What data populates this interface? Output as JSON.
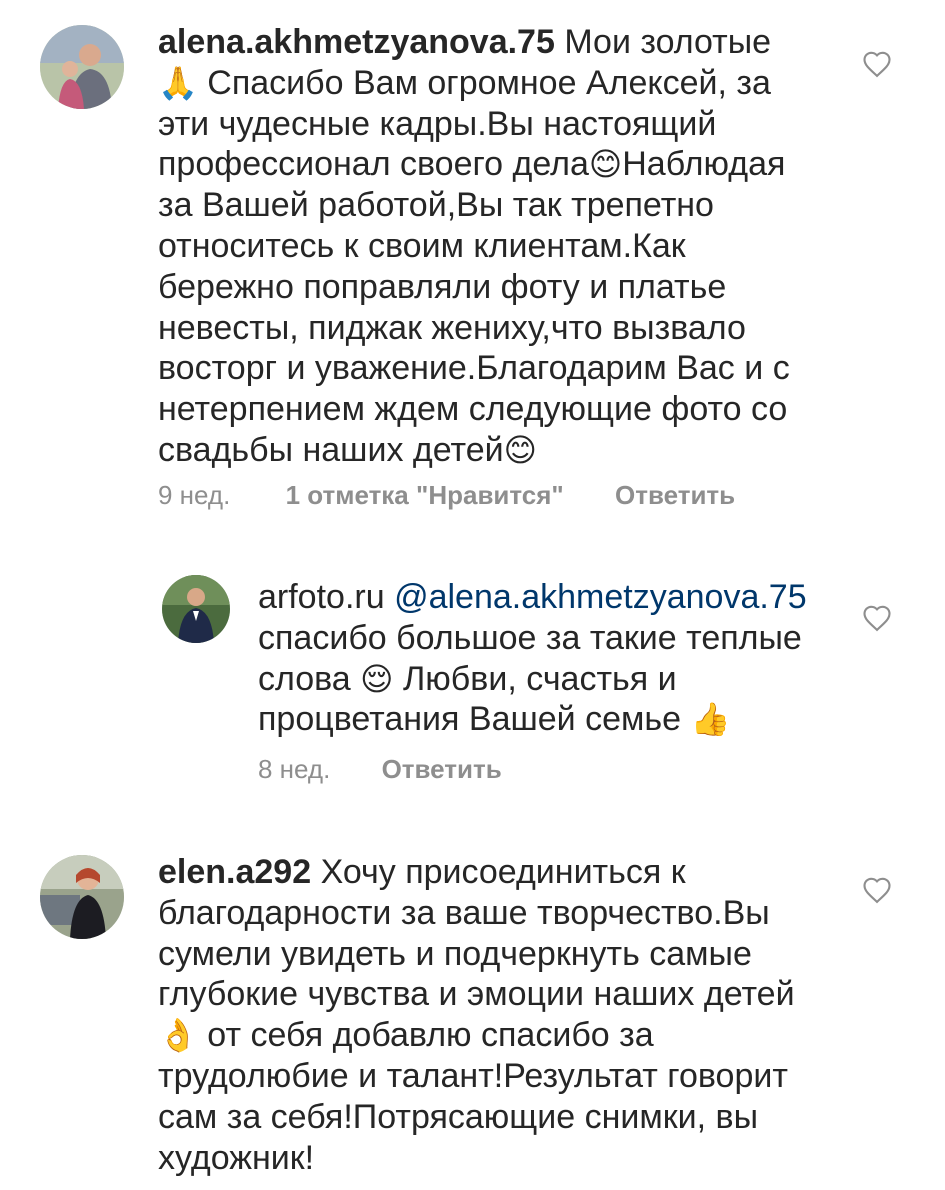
{
  "comments": [
    {
      "username": "alena.akhmetzyanova.75",
      "text_part1": " Мои золотые",
      "emoji_pray": "🙏",
      "text_part2": " Спасибо Вам огромное Алексей, за эти чудесные кадры.Вы настоящий профессионал своего дела",
      "emoji_smile1": "😊",
      "text_part3": "Наблюдая за Вашей работой,Вы так трепетно относитесь к своим клиентам.Как бережно поправляли фоту и  платье невесты, пиджак жениху,что вызвало восторг и уважение.Благодарим Вас и с нетерпением ждем следующие  фото со свадьбы наших детей",
      "emoji_smile2": "😊",
      "time": "9 нед.",
      "likes": "1 отметка \"Нравится\"",
      "reply": "Ответить"
    },
    {
      "username": "arfoto.ru",
      "mention": "@alena.akhmetzyanova.75",
      "text_part1": " спасибо большое за такие теплые слова ",
      "emoji_relieved": "😌",
      "text_part2": " Любви, счастья и процветания Вашей семье ",
      "emoji_thumb": "👍",
      "time": "8 нед.",
      "reply": "Ответить"
    },
    {
      "username": "elen.a292",
      "text_part1": " Хочу присоединиться к благодарности за ваше творчество.Вы сумели увидеть и подчеркнуть самые глубокие чувства и эмоции  наших детей",
      "emoji_ok": "👌",
      "text_part2": " от себя добавлю спасибо за трудолюбие и талант!Результат говорит сам за себя!Потрясающие снимки, вы художник!"
    }
  ],
  "icons": {
    "heart": "heart-outline-icon"
  },
  "colors": {
    "text": "#262626",
    "secondary": "#8e8e8e",
    "mention": "#00376b"
  }
}
